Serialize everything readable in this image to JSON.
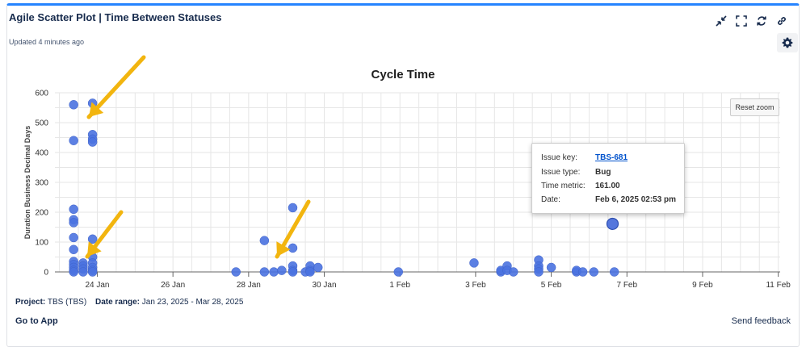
{
  "header": {
    "title": "Agile Scatter Plot | Time Between Statuses",
    "updated": "Updated 4 minutes ago",
    "toolbar_icons": [
      "collapse-icon",
      "fullscreen-icon",
      "refresh-icon",
      "link-icon"
    ],
    "settings_icon": "gear-icon",
    "accent_color": "#2684ff"
  },
  "chart_data": {
    "type": "scatter",
    "title": "Cycle Time",
    "xlabel": "",
    "ylabel": "Duration Business Decimal Days",
    "ylim": [
      0,
      600
    ],
    "yticks": [
      "0",
      "100",
      "200",
      "300",
      "400",
      "500",
      "600"
    ],
    "xlim": [
      "2025-01-23",
      "2025-02-11"
    ],
    "xticks": [
      {
        "date": "2025-01-24",
        "label": "24 Jan"
      },
      {
        "date": "2025-01-26",
        "label": "26 Jan"
      },
      {
        "date": "2025-01-28",
        "label": "28 Jan"
      },
      {
        "date": "2025-01-30",
        "label": "30 Jan"
      },
      {
        "date": "2025-02-01",
        "label": "1 Feb"
      },
      {
        "date": "2025-02-03",
        "label": "3 Feb"
      },
      {
        "date": "2025-02-05",
        "label": "5 Feb"
      },
      {
        "date": "2025-02-07",
        "label": "7 Feb"
      },
      {
        "date": "2025-02-09",
        "label": "9 Feb"
      },
      {
        "date": "2025-02-11",
        "label": "11 Feb"
      }
    ],
    "grid": true,
    "point_color": "#4a72e0",
    "series": [
      {
        "points": [
          [
            "2025-01-23 09:00",
            560
          ],
          [
            "2025-01-23 09:00",
            440
          ],
          [
            "2025-01-23 09:00",
            210
          ],
          [
            "2025-01-23 09:00",
            175
          ],
          [
            "2025-01-23 09:00",
            165
          ],
          [
            "2025-01-23 09:00",
            115
          ],
          [
            "2025-01-23 09:00",
            75
          ],
          [
            "2025-01-23 09:00",
            35
          ],
          [
            "2025-01-23 09:00",
            25
          ],
          [
            "2025-01-23 09:00",
            15
          ],
          [
            "2025-01-23 09:00",
            5
          ],
          [
            "2025-01-23 09:00",
            0
          ],
          [
            "2025-01-23 15:00",
            30
          ],
          [
            "2025-01-23 15:00",
            20
          ],
          [
            "2025-01-23 15:00",
            10
          ],
          [
            "2025-01-23 15:00",
            0
          ],
          [
            "2025-01-23 21:00",
            565
          ],
          [
            "2025-01-23 21:00",
            460
          ],
          [
            "2025-01-23 21:00",
            445
          ],
          [
            "2025-01-23 21:00",
            435
          ],
          [
            "2025-01-23 21:00",
            110
          ],
          [
            "2025-01-23 21:00",
            50
          ],
          [
            "2025-01-23 21:00",
            30
          ],
          [
            "2025-01-23 21:00",
            15
          ],
          [
            "2025-01-23 21:00",
            5
          ],
          [
            "2025-01-23 21:00",
            0
          ],
          [
            "2025-01-27 16:00",
            0
          ],
          [
            "2025-01-28 10:00",
            105
          ],
          [
            "2025-01-28 10:00",
            0
          ],
          [
            "2025-01-28 16:00",
            0
          ],
          [
            "2025-01-28 21:00",
            5
          ],
          [
            "2025-01-29 04:00",
            215
          ],
          [
            "2025-01-29 04:00",
            80
          ],
          [
            "2025-01-29 04:00",
            20
          ],
          [
            "2025-01-29 04:00",
            5
          ],
          [
            "2025-01-29 04:00",
            0
          ],
          [
            "2025-01-29 12:00",
            0
          ],
          [
            "2025-01-29 15:00",
            20
          ],
          [
            "2025-01-29 15:00",
            5
          ],
          [
            "2025-01-29 15:00",
            0
          ],
          [
            "2025-01-29 20:00",
            15
          ],
          [
            "2025-01-31 23:00",
            0
          ],
          [
            "2025-02-02 23:00",
            30
          ],
          [
            "2025-02-03 16:00",
            0
          ],
          [
            "2025-02-03 16:00",
            5
          ],
          [
            "2025-02-03 20:00",
            20
          ],
          [
            "2025-02-03 20:00",
            5
          ],
          [
            "2025-02-04 00:00",
            0
          ],
          [
            "2025-02-04 16:00",
            40
          ],
          [
            "2025-02-04 16:00",
            20
          ],
          [
            "2025-02-04 16:00",
            10
          ],
          [
            "2025-02-04 16:00",
            0
          ],
          [
            "2025-02-05 00:00",
            15
          ],
          [
            "2025-02-05 16:00",
            0
          ],
          [
            "2025-02-05 16:00",
            5
          ],
          [
            "2025-02-05 20:00",
            0
          ],
          [
            "2025-02-06 03:00",
            0
          ],
          [
            "2025-02-06 14:53",
            161
          ],
          [
            "2025-02-06 16:00",
            0
          ]
        ]
      }
    ],
    "highlight": [
      "2025-02-06 14:53",
      161
    ]
  },
  "reset_zoom": "Reset zoom",
  "tooltip": {
    "issue_key_label": "Issue key:",
    "issue_key": "TBS-681",
    "issue_type_label": "Issue type:",
    "issue_type": "Bug",
    "time_metric_label": "Time metric:",
    "time_metric": "161.00",
    "date_label": "Date:",
    "date": "Feb 6, 2025 02:53 pm"
  },
  "annotations": {
    "arrow_color": "#f2b50f",
    "arrow_count": 3
  },
  "footer": {
    "project_label": "Project:",
    "project_value": "TBS (TBS)",
    "date_range_label": "Date range:",
    "date_range_value": "Jan 23, 2025 - Mar 28, 2025",
    "go_to_app": "Go to App",
    "send_feedback": "Send feedback"
  }
}
